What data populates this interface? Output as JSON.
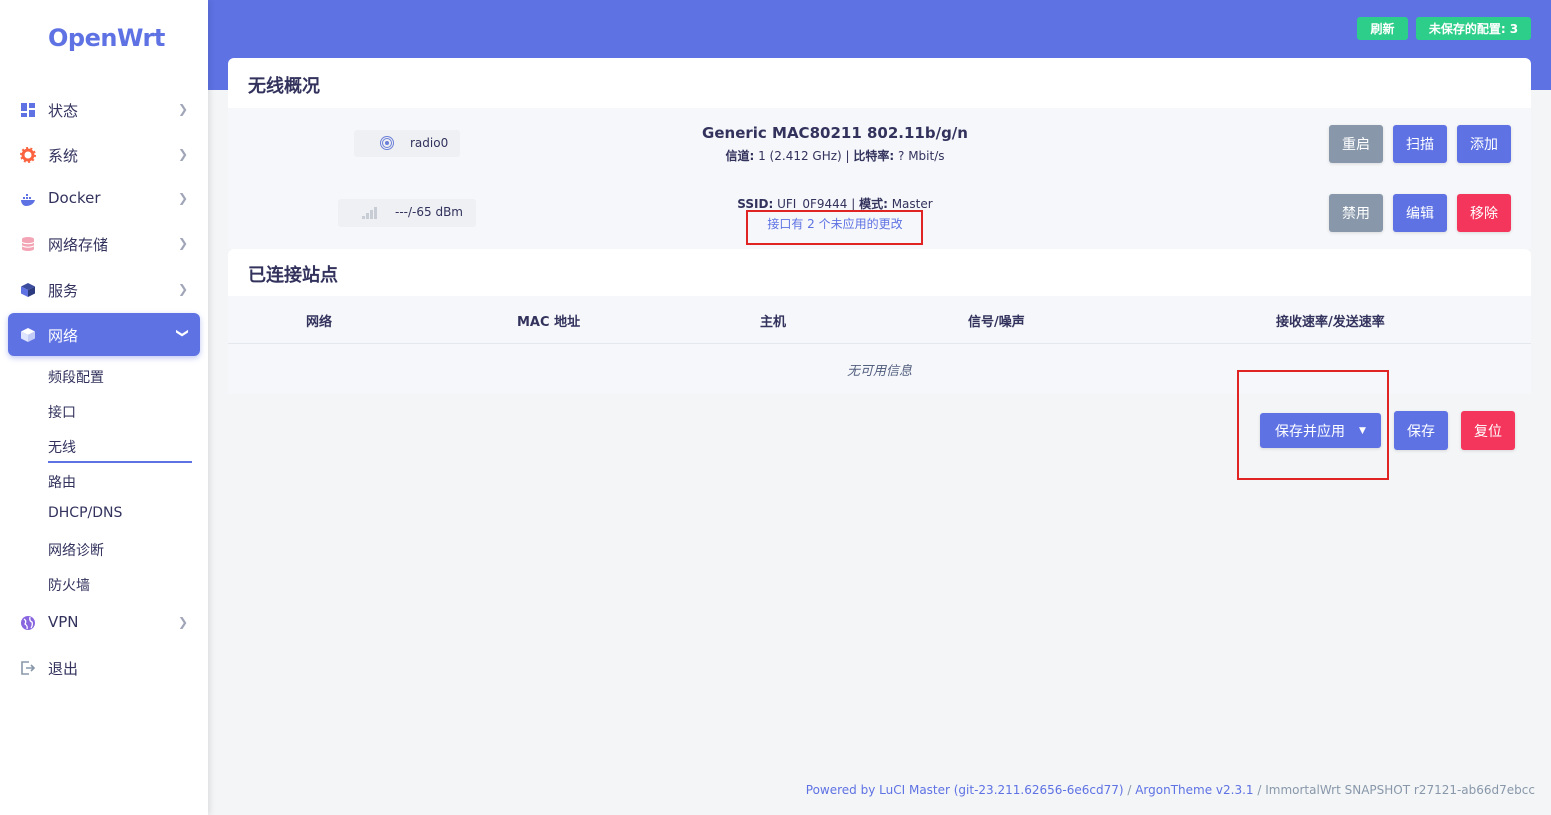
{
  "app": {
    "logo": "OpenWrt"
  },
  "sidebar": {
    "items": [
      {
        "label": "状态",
        "icon": "dashboard-icon"
      },
      {
        "label": "系统",
        "icon": "gear-icon"
      },
      {
        "label": "Docker",
        "icon": "docker-icon"
      },
      {
        "label": "网络存储",
        "icon": "database-icon"
      },
      {
        "label": "服务",
        "icon": "cube-icon"
      },
      {
        "label": "网络",
        "icon": "cube-icon"
      },
      {
        "label": "VPN",
        "icon": "globe-icon"
      },
      {
        "label": "退出",
        "icon": "logout-icon"
      }
    ],
    "sub_items": [
      "频段配置",
      "接口",
      "无线",
      "路由",
      "DHCP/DNS",
      "网络诊断",
      "防火墙"
    ]
  },
  "header": {
    "refresh_label": "刷新",
    "unsaved_label": "未保存的配置: 3"
  },
  "wireless": {
    "title": "无线概况",
    "radio": {
      "badge_label": "radio0",
      "name": "Generic MAC80211 802.11b/g/n",
      "channel_label": "信道:",
      "channel_value": " 1 (2.412 GHz) | ",
      "bitrate_label": "比特率:",
      "bitrate_value": " ? Mbit/s",
      "buttons": {
        "restart": "重启",
        "scan": "扫描",
        "add": "添加"
      }
    },
    "iface": {
      "signal_badge": "---/-65 dBm",
      "ssid_label": "SSID:",
      "ssid_value": " UFI_0F9444 | ",
      "mode_label": "模式:",
      "mode_value": " Master",
      "pending_changes": "接口有 2 个未应用的更改",
      "buttons": {
        "disable": "禁用",
        "edit": "编辑",
        "remove": "移除"
      }
    }
  },
  "stations": {
    "title": "已连接站点",
    "columns": [
      "网络",
      "MAC 地址",
      "主机",
      "信号/噪声",
      "接收速率/发送速率"
    ],
    "empty": "无可用信息"
  },
  "actions": {
    "save_apply": "保存并应用",
    "save": "保存",
    "reset": "复位"
  },
  "footer": {
    "luci": "Powered by LuCI Master (git-23.211.62656-6e6cd77)",
    "sep1": " / ",
    "theme": "ArgonTheme v2.3.1",
    "sep2": " / ",
    "build": "ImmortalWrt SNAPSHOT r27121-ab66d7ebcc"
  },
  "colors": {
    "accent": "#5e72e4",
    "success": "#2dce89",
    "danger": "#f5365c",
    "muted": "#8898aa",
    "highlight": "#e02424"
  }
}
